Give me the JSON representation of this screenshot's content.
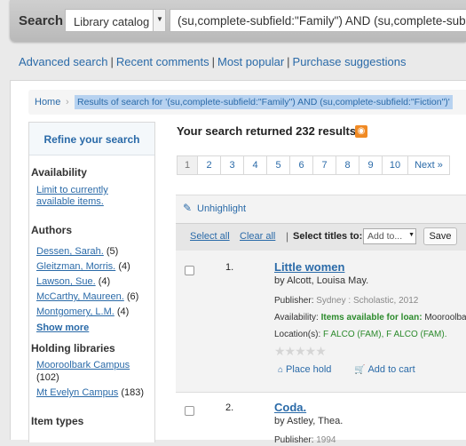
{
  "search": {
    "label": "Search",
    "scope": "Library catalog",
    "query": "(su,complete-subfield:\"Family\") AND (su,complete-subfield:\"Fiction\")"
  },
  "toplinks": [
    "Advanced search",
    "Recent comments",
    "Most popular",
    "Purchase suggestions"
  ],
  "breadcrumb": {
    "home": "Home",
    "current": "Results of search for '(su,complete-subfield:\"Family\") AND (su,complete-subfield:\"Fiction\")'"
  },
  "facets": {
    "refine_title": "Refine your search",
    "availability": {
      "heading": "Availability",
      "line1": "Limit to currently",
      "line2": "available items."
    },
    "authors": {
      "heading": "Authors",
      "items": [
        {
          "name": "Dessen, Sarah.",
          "count": "(5)"
        },
        {
          "name": "Gleitzman, Morris.",
          "count": "(4)"
        },
        {
          "name": "Lawson, Sue.",
          "count": "(4)"
        },
        {
          "name": "McCarthy, Maureen.",
          "count": "(6)"
        },
        {
          "name": "Montgomery, L.M.",
          "count": "(4)"
        }
      ],
      "show_more": "Show more"
    },
    "holding": {
      "heading": "Holding libraries",
      "items": [
        {
          "name": "Mooroolbark Campus",
          "count": "(102)"
        },
        {
          "name": "Mt Evelyn Campus",
          "count": "(183)"
        }
      ]
    },
    "item_types": {
      "heading": "Item types"
    }
  },
  "results": {
    "count_text": "Your search returned 232 results.",
    "pages": [
      "1",
      "2",
      "3",
      "4",
      "5",
      "6",
      "7",
      "8",
      "9",
      "10",
      "Next »"
    ],
    "current_page": "1",
    "unhighlight": "Unhighlight",
    "select_all": "Select all",
    "clear_all": "Clear all",
    "select_titles_to": "Select titles to:",
    "add_to": "Add to...",
    "save": "Save",
    "items": [
      {
        "num": "1.",
        "title": "Little women",
        "by": "by Alcott, Louisa May.",
        "publisher_label": "Publisher:",
        "publisher": "Sydney : Scholastic, 2012",
        "availability_label": "Availability:",
        "availability_green": "Items available for loan:",
        "availability_rest": "Mooroolbark",
        "location_label": "Location(s):",
        "location": "F ALCO (FAM), F ALCO (FAM).",
        "place_hold": "Place hold",
        "add_to_cart": "Add to cart"
      },
      {
        "num": "2.",
        "title": "Coda.",
        "by": "by Astley, Thea.",
        "publisher_label": "Publisher:",
        "publisher": "1994"
      }
    ]
  },
  "colors": {
    "link": "#2a6aa8",
    "available": "#2b8a2b",
    "rss": "#f08a24",
    "highlight": "#b7d2f0"
  }
}
